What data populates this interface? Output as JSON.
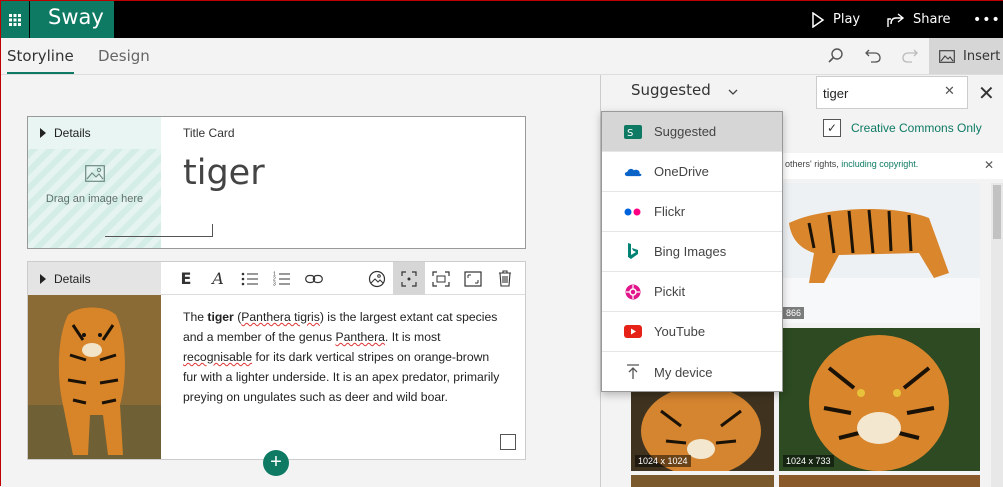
{
  "app": {
    "brand": "Sway"
  },
  "topbar": {
    "play_label": "Play",
    "share_label": "Share",
    "more_label": "•••"
  },
  "tabs": [
    {
      "label": "Storyline"
    },
    {
      "label": "Design"
    }
  ],
  "toolbar": {
    "insert_label": "Insert"
  },
  "title_card": {
    "details_label": "Details",
    "drag_text": "Drag an image here",
    "label": "Title Card",
    "title": "tiger"
  },
  "text_card": {
    "details_label": "Details",
    "tools": [
      "E",
      "A"
    ],
    "body": {
      "p1": "The ",
      "bold": "tiger",
      "p2": " (",
      "sci": "Panthera tigris",
      "p3": ") is the largest extant cat species and a member of the genus ",
      "genus": "Panthera",
      "p4": ". It is most ",
      "recog": "recognisable",
      "p5": " for its dark vertical stripes on orange-brown fur with a lighter underside. It is an apex predator, primarily preying on ungulates such as deer and wild boar."
    },
    "add_label": "+"
  },
  "panel": {
    "header": "Suggested",
    "search_value": "tiger",
    "cc_label": "Creative Commons Only",
    "notice_text": "others' rights, ",
    "notice_link": "including copyright.",
    "images": [
      {
        "size": "866"
      },
      {
        "size": "1024 x 1024"
      },
      {
        "size": "1024 x 733"
      }
    ]
  },
  "dropdown": {
    "items": [
      {
        "label": "Suggested",
        "color": "#0e7a64"
      },
      {
        "label": "OneDrive",
        "color": "#0a64c8"
      },
      {
        "label": "Flickr",
        "color": "#ff0084"
      },
      {
        "label": "Bing Images",
        "color": "#008373"
      },
      {
        "label": "Pickit",
        "color": "#e0168a"
      },
      {
        "label": "YouTube",
        "color": "#e62117"
      },
      {
        "label": "My device",
        "color": "#555555"
      }
    ]
  }
}
